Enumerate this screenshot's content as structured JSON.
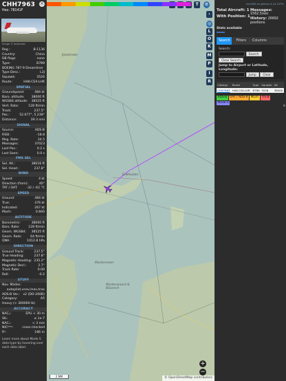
{
  "aircraft": {
    "callsign": "CHH7963",
    "hex_line": "Hex: 78141F",
    "close_label": "×",
    "photo_credit": "Image © Jetphotos",
    "basic": [
      {
        "k": "Reg.:",
        "v": "B-1136"
      },
      {
        "k": "Country:",
        "v": "China"
      },
      {
        "k": "DB flags:",
        "v": "none"
      },
      {
        "k": "Type:",
        "v": "B789"
      },
      {
        "k": "BOEING 787-9 Dreamliner",
        "v": ""
      },
      {
        "k": "Type Desc.:",
        "v": "L2J"
      },
      {
        "k": "Squawk:",
        "v": "3526"
      },
      {
        "k": "Route:",
        "v": "HAK-CSX-LHR"
      }
    ],
    "sections": [
      {
        "title": "SPATIAL",
        "rows": [
          {
            "k": "Groundspeed:",
            "v": "484 kt"
          },
          {
            "k": "Baro. altitude:",
            "v": "38000 ft"
          },
          {
            "k": "WGS84 altitude:",
            "v": "38525 ft"
          },
          {
            "k": "Vert. Rate:",
            "v": "128 ft/min"
          },
          {
            "k": "Track:",
            "v": "237.5°"
          },
          {
            "k": "Pos.:",
            "v": "52.677°, 5.239°"
          },
          {
            "k": "Distance:",
            "v": "39.3 nmi"
          }
        ]
      },
      {
        "title": "SIGNAL",
        "rows": [
          {
            "k": "Source:",
            "v": "ADS-B"
          },
          {
            "k": "RSSI:",
            "v": "-18.8"
          },
          {
            "k": "Msg. Rate:",
            "v": "34.5"
          },
          {
            "k": "Messages:",
            "v": "37023"
          },
          {
            "k": "Last Pos.:",
            "v": "0.2 s"
          },
          {
            "k": "Last Seen:",
            "v": "0.0 s"
          }
        ]
      },
      {
        "title": "FMS SEL",
        "rows": [
          {
            "k": "Sel. Alt.:",
            "v": "38016 ft"
          },
          {
            "k": "Sel. Head.:",
            "v": "237.8°"
          }
        ]
      },
      {
        "title": "WIND",
        "rows": [
          {
            "k": "Speed:",
            "v": "4 kt"
          },
          {
            "k": "Direction (from):",
            "v": "40°"
          },
          {
            "k": "TAT / OAT:",
            "v": "-32 / -62 °C"
          }
        ]
      },
      {
        "title": "SPEED",
        "rows": [
          {
            "k": "Ground:",
            "v": "484 kt"
          },
          {
            "k": "True:",
            "v": "476 kt"
          },
          {
            "k": "Indicated:",
            "v": "267 kt"
          },
          {
            "k": "Mach:",
            "v": "0.840"
          }
        ]
      },
      {
        "title": "ALTITUDE",
        "rows": [
          {
            "k": "Barometric:",
            "v": "38000 ft"
          },
          {
            "k": "Baro. Rate:",
            "v": "128 ft/min"
          },
          {
            "k": "Geom. WGS84:",
            "v": "38525 ft"
          },
          {
            "k": "Geom. Rate:",
            "v": "64 ft/min"
          },
          {
            "k": "QNH:",
            "v": "1012.8 hPa"
          }
        ]
      },
      {
        "title": "DIRECTION",
        "rows": [
          {
            "k": "Ground Track:",
            "v": "237.5°"
          },
          {
            "k": "True Heading:",
            "v": "237.8°"
          },
          {
            "k": "Magnetic Heading:",
            "v": "235.2°"
          },
          {
            "k": "Magnetic Decl.:",
            "v": "2.7°"
          },
          {
            "k": "Track Rate:",
            "v": "0.00"
          },
          {
            "k": "Roll:",
            "v": "-0.2"
          }
        ]
      },
      {
        "title": "STUFF",
        "rows": [
          {
            "k": "Nav. Modes:",
            "v": ""
          },
          {
            "k": "",
            "v": "autopilot,vnav,lnav,tcas"
          },
          {
            "k": "ADS-B Ver.:",
            "v": "v2 (DO-260B)"
          },
          {
            "k": "Category:",
            "v": "A5"
          },
          {
            "k": "Heavy (> 300000 lb)",
            "v": ""
          }
        ]
      },
      {
        "title": "ACCURACY",
        "rows": [
          {
            "k": "NACₚ:",
            "v": "EPU < 30 m"
          },
          {
            "k": "SIL:",
            "v": "≤ 1e-7"
          },
          {
            "k": "NACᵥ:",
            "v": "< 3 m/s"
          },
          {
            "k": "NICᵇᵃʳᵒ:",
            "v": "cross-checked"
          },
          {
            "k": "Rᶜ:",
            "v": "186 m"
          }
        ]
      }
    ],
    "footer_text": "Learn more about Mode S data type by hovering over each data label."
  },
  "map": {
    "top_buttons": [
      "L",
      "U",
      "H",
      "T"
    ],
    "side_buttons": [
      "L",
      "O",
      "K",
      "M",
      "P",
      "I",
      "R"
    ],
    "nav_arrow": "›",
    "zoom_in": "+",
    "zoom_out": "−",
    "scale_label": "2 NM",
    "attribution": "© OpenStreetMap contributors",
    "places": [
      "IJsselmeer",
      "Enkhuizen",
      "Markermeer",
      "Markerwaard & Blaarsch"
    ],
    "legend_color_stops": [
      "#ff5500",
      "#ff9900",
      "#ccdd00",
      "#44cc00",
      "#00cc66",
      "#00bbcc",
      "#0088ff",
      "#3344ff",
      "#8833ff",
      "#dd22dd"
    ],
    "track_color": "#b04cff"
  },
  "sidebar": {
    "version_link": "tar1090 on github (3.14.1579)",
    "total_label": "Total Aircraft:",
    "total_value": "1",
    "position_label": "With Position:",
    "position_value": "1",
    "messages_label": "Messages:",
    "messages_value": "1562.5/sec",
    "history_label": "History:",
    "history_value": "26692 positions",
    "stats_link": "Stats available",
    "tabs": [
      "Search",
      "Filters",
      "Columns"
    ],
    "search_label": "Search:",
    "search_button": "Search",
    "clear_search_button": "Clear Search",
    "jump_label": "Jump to Airport or Latitude, Longitude:",
    "jump_button": "Jump",
    "clear_button": "Clear",
    "table": {
      "headers": [
        "Callsign",
        "Route",
        "Type",
        "Squawk",
        "Alt"
      ],
      "rows": [
        [
          "CHH7963",
          "HAK-CSX-LHR",
          "B789",
          "3526",
          "38000"
        ]
      ]
    },
    "badges": [
      {
        "label": "ADS-B",
        "color": "#44cc44"
      },
      {
        "label": "UAT / ADS-R",
        "color": "#ffaa33"
      },
      {
        "label": "MLAT",
        "color": "#ffcc33"
      },
      {
        "label": "TIS-B",
        "color": "#ff6666"
      },
      {
        "label": "Mode-S",
        "color": "#8888ff"
      }
    ]
  }
}
